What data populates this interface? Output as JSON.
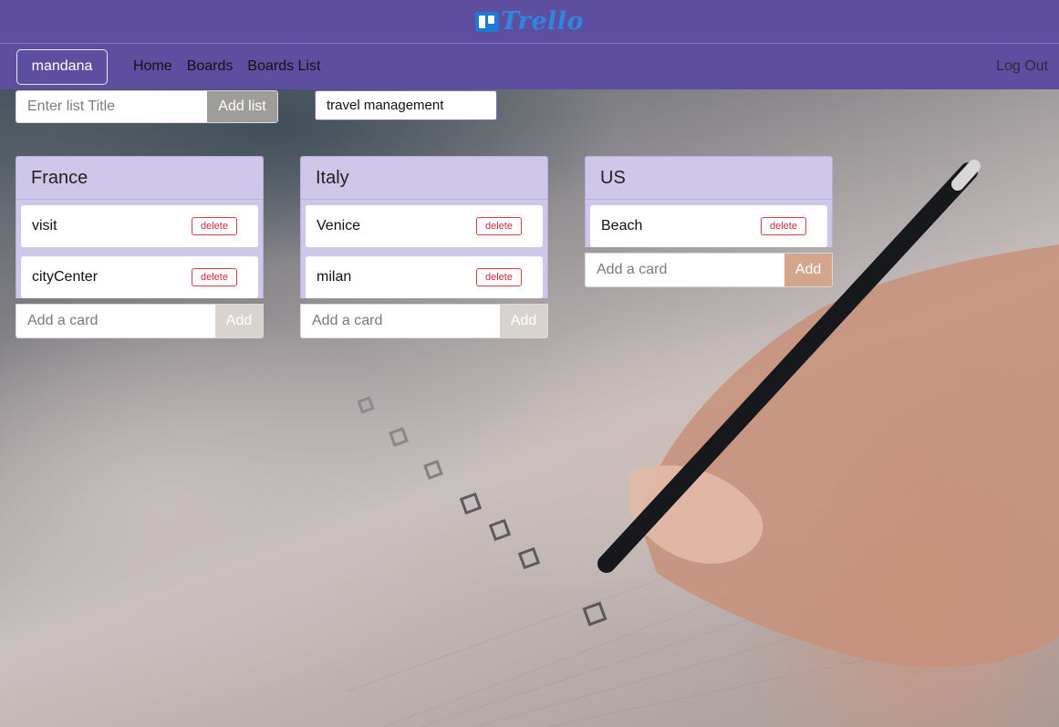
{
  "brand": {
    "name": "Trello"
  },
  "nav": {
    "user": "mandana",
    "links": [
      "Home",
      "Boards",
      "Boards List"
    ],
    "logout": "Log Out"
  },
  "controls": {
    "list_title_placeholder": "Enter list Title",
    "add_list_label": "Add list",
    "board_title": "travel management"
  },
  "lists": [
    {
      "title": "France",
      "cards": [
        "visit",
        "cityCenter"
      ],
      "add_placeholder": "Add a card",
      "add_label": "Add"
    },
    {
      "title": "Italy",
      "cards": [
        "Venice",
        "milan"
      ],
      "add_placeholder": "Add a card",
      "add_label": "Add"
    },
    {
      "title": "US",
      "cards": [
        "Beach"
      ],
      "add_placeholder": "Add a card",
      "add_label": "Add"
    }
  ],
  "card_delete_label": "delete",
  "colors": {
    "header": "#5e4e9f",
    "list_bg": "#cfc7e9",
    "delete": "#c72b3a",
    "logo": "#2f86df"
  }
}
